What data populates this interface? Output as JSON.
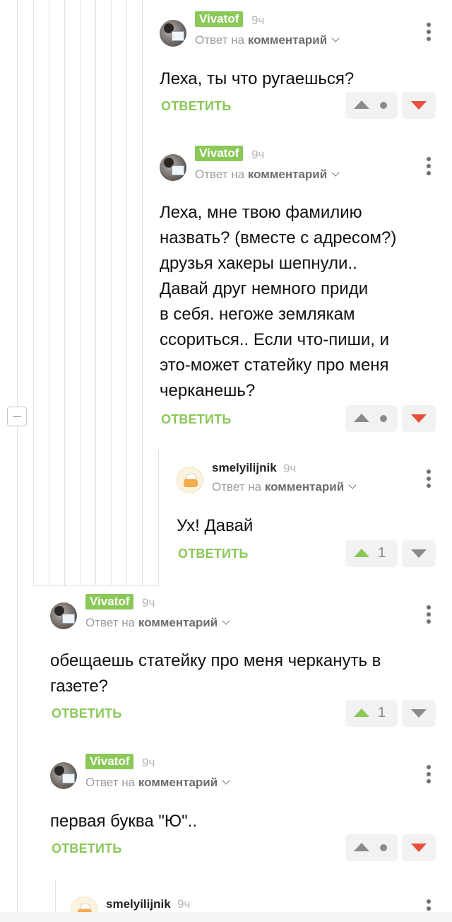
{
  "reply_label": "ОТВЕТИТЬ",
  "reply_to_prefix": "Ответ на",
  "reply_to_target": "комментарий",
  "comments": [
    {
      "user": "Vivatof",
      "time": "9ч",
      "text": "Леха, ты что ругаешься?",
      "votes": "",
      "vote_state": "neutral"
    },
    {
      "user": "Vivatof",
      "time": "9ч",
      "text": "Леха, мне твою фамилию\nназвать? (вместе с адресом?)\nдрузья хакеры шепнули..\nДавай друг немного приди\nв себя. негоже землякам\nссориться.. Если что-пиши, и\nэто-может статейку про меня\nчерканешь?",
      "votes": "",
      "vote_state": "neutral"
    },
    {
      "user": "smelyilijnik",
      "time": "9ч",
      "text": "Ух! Давай",
      "votes": "1",
      "vote_state": "up"
    },
    {
      "user": "Vivatof",
      "time": "9ч",
      "text": "обещаешь статейку про меня черкануть в\nгазете?",
      "votes": "1",
      "vote_state": "up"
    },
    {
      "user": "Vivatof",
      "time": "9ч",
      "text": "первая буква \"Ю\"..",
      "votes": "",
      "vote_state": "neutral"
    },
    {
      "user": "smelyilijnik",
      "time": "9ч"
    }
  ],
  "colors": {
    "accent_green": "#8ac858",
    "downvote_red": "#e8503b",
    "muted_gray": "#8b8b8b"
  }
}
